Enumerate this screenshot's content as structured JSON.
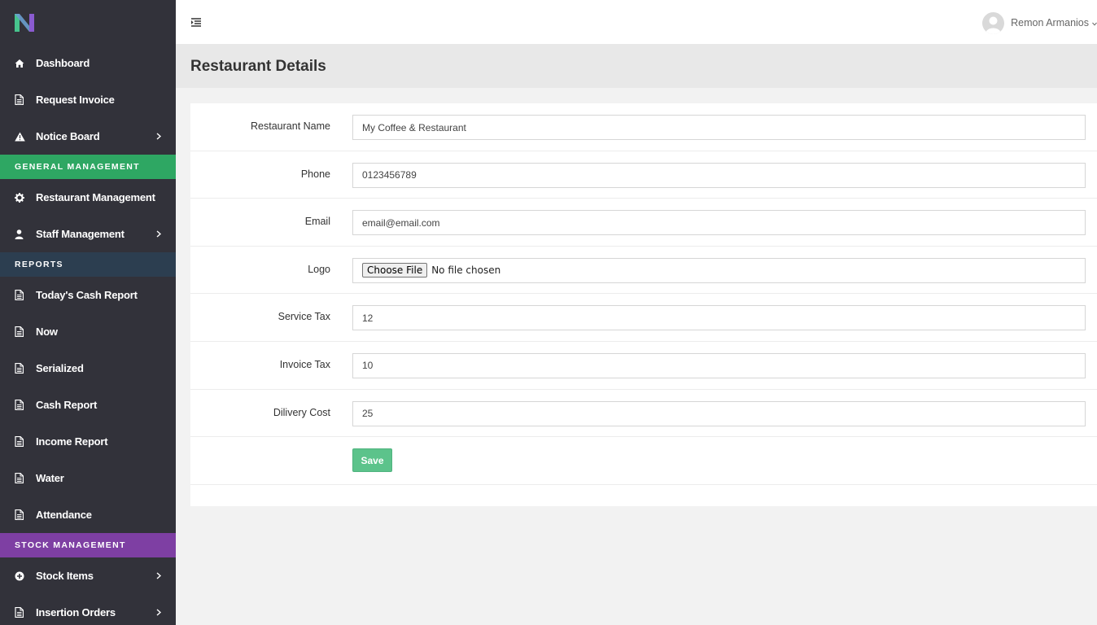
{
  "colors": {
    "sidebar_bg": "#32323a",
    "section_general": "#2ea763",
    "section_reports": "#2c3e50",
    "section_stock": "#7e3fa3",
    "save_button": "#5cc38b",
    "logo_green": "#47c48d",
    "logo_purple": "#8a5bd0"
  },
  "sidebar": {
    "brand_icon": "logo-n-icon",
    "items_top": [
      {
        "label": "Dashboard",
        "icon": "home-icon"
      },
      {
        "label": "Request Invoice",
        "icon": "file-icon"
      },
      {
        "label": "Notice Board",
        "icon": "warning-icon",
        "has_submenu": true
      }
    ],
    "section_general": "GENERAL MANAGEMENT",
    "items_general": [
      {
        "label": "Restaurant Management",
        "icon": "gear-icon"
      },
      {
        "label": "Staff Management",
        "icon": "user-icon",
        "has_submenu": true
      }
    ],
    "section_reports": "REPORTS",
    "items_reports": [
      {
        "label": "Today's Cash Report",
        "icon": "file-icon"
      },
      {
        "label": "Now",
        "icon": "file-icon"
      },
      {
        "label": "Serialized",
        "icon": "file-icon"
      },
      {
        "label": "Cash Report",
        "icon": "file-icon"
      },
      {
        "label": "Income Report",
        "icon": "file-icon"
      },
      {
        "label": "Water",
        "icon": "file-icon"
      },
      {
        "label": "Attendance",
        "icon": "file-icon"
      }
    ],
    "section_stock": "STOCK MANAGEMENT",
    "items_stock": [
      {
        "label": "Stock Items",
        "icon": "plus-circle-icon",
        "has_submenu": true
      },
      {
        "label": "Insertion Orders",
        "icon": "file-icon",
        "has_submenu": true
      }
    ]
  },
  "topbar": {
    "toggle_icon": "menu-toggle-icon",
    "user_name": "Remon Armanios"
  },
  "page": {
    "title": "Restaurant Details"
  },
  "form": {
    "restaurant_name": {
      "label": "Restaurant Name",
      "value": "My Coffee & Restaurant"
    },
    "phone": {
      "label": "Phone",
      "value": "0123456789"
    },
    "email": {
      "label": "Email",
      "value": "email@email.com"
    },
    "logo": {
      "label": "Logo",
      "button": "Choose File",
      "status": "No file chosen"
    },
    "service_tax": {
      "label": "Service Tax",
      "value": "12"
    },
    "invoice_tax": {
      "label": "Invoice Tax",
      "value": "10"
    },
    "delivery_cost": {
      "label": "Dilivery Cost",
      "value": "25"
    },
    "save_label": "Save"
  }
}
